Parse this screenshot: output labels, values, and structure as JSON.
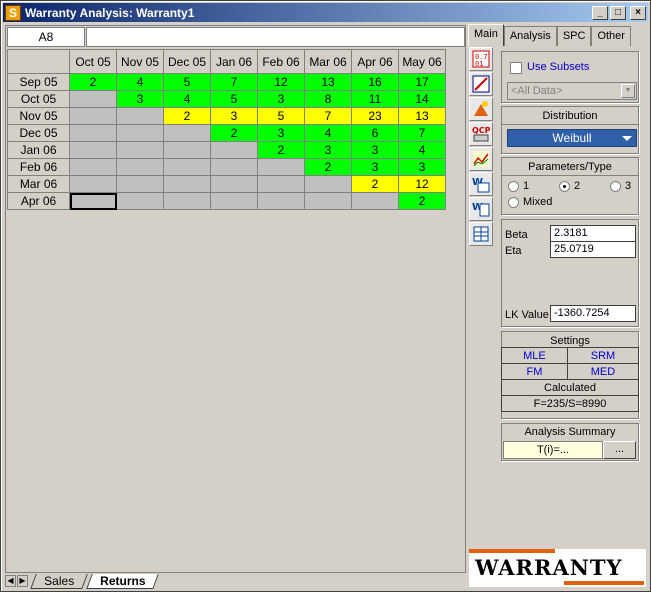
{
  "window": {
    "title": "Warranty Analysis: Warranty1",
    "minimize": "_",
    "maximize": "□",
    "close": "×"
  },
  "sheet": {
    "cell_ref": "A8",
    "formula": "",
    "columns": [
      "Oct 05",
      "Nov 05",
      "Dec 05",
      "Jan 06",
      "Feb 06",
      "Mar 06",
      "Apr 06",
      "May 06"
    ],
    "rows": [
      {
        "label": "Sep 05",
        "cells": [
          [
            "2",
            "g"
          ],
          [
            "4",
            "g"
          ],
          [
            "5",
            "g"
          ],
          [
            "7",
            "g"
          ],
          [
            "12",
            "g"
          ],
          [
            "13",
            "g"
          ],
          [
            "16",
            "g"
          ],
          [
            "17",
            "g"
          ]
        ]
      },
      {
        "label": "Oct 05",
        "cells": [
          [
            "",
            "e"
          ],
          [
            "3",
            "g"
          ],
          [
            "4",
            "g"
          ],
          [
            "5",
            "g"
          ],
          [
            "3",
            "g"
          ],
          [
            "8",
            "g"
          ],
          [
            "11",
            "g"
          ],
          [
            "14",
            "g"
          ]
        ]
      },
      {
        "label": "Nov 05",
        "cells": [
          [
            "",
            "e"
          ],
          [
            "",
            "e"
          ],
          [
            "2",
            "y"
          ],
          [
            "3",
            "y"
          ],
          [
            "5",
            "y"
          ],
          [
            "7",
            "y"
          ],
          [
            "23",
            "y"
          ],
          [
            "13",
            "y"
          ]
        ]
      },
      {
        "label": "Dec 05",
        "cells": [
          [
            "",
            "e"
          ],
          [
            "",
            "e"
          ],
          [
            "",
            "e"
          ],
          [
            "2",
            "g"
          ],
          [
            "3",
            "g"
          ],
          [
            "4",
            "g"
          ],
          [
            "6",
            "g"
          ],
          [
            "7",
            "g"
          ]
        ]
      },
      {
        "label": "Jan 06",
        "cells": [
          [
            "",
            "e"
          ],
          [
            "",
            "e"
          ],
          [
            "",
            "e"
          ],
          [
            "",
            "e"
          ],
          [
            "2",
            "g"
          ],
          [
            "3",
            "g"
          ],
          [
            "3",
            "g"
          ],
          [
            "4",
            "g"
          ]
        ]
      },
      {
        "label": "Feb 06",
        "cells": [
          [
            "",
            "e"
          ],
          [
            "",
            "e"
          ],
          [
            "",
            "e"
          ],
          [
            "",
            "e"
          ],
          [
            "",
            "e"
          ],
          [
            "2",
            "g"
          ],
          [
            "3",
            "g"
          ],
          [
            "3",
            "g"
          ]
        ]
      },
      {
        "label": "Mar 06",
        "cells": [
          [
            "",
            "e"
          ],
          [
            "",
            "e"
          ],
          [
            "",
            "e"
          ],
          [
            "",
            "e"
          ],
          [
            "",
            "e"
          ],
          [
            "",
            "e"
          ],
          [
            "2",
            "y"
          ],
          [
            "12",
            "y"
          ]
        ]
      },
      {
        "label": "Apr 06",
        "cells": [
          [
            "",
            "sel"
          ],
          [
            "",
            "e"
          ],
          [
            "",
            "e"
          ],
          [
            "",
            "e"
          ],
          [
            "",
            "e"
          ],
          [
            "",
            "e"
          ],
          [
            "",
            "e"
          ],
          [
            "2",
            "g"
          ]
        ]
      }
    ],
    "tabs": [
      "Sales",
      "Returns"
    ],
    "active_tab": "Returns"
  },
  "panel": {
    "tabs": [
      "Main",
      "Analysis",
      "SPC",
      "Other"
    ],
    "active_tab": "Main",
    "use_subsets": "Use Subsets",
    "subset_combo": "<All Data>",
    "distribution_header": "Distribution",
    "distribution_value": "Weibull",
    "params_header": "Parameters/Type",
    "param_options": [
      "1",
      "2",
      "3",
      "Mixed"
    ],
    "param_selected": "2",
    "beta_label": "Beta",
    "beta_value": "2.3181",
    "eta_label": "Eta",
    "eta_value": "25.0719",
    "lk_label": "LK Value",
    "lk_value": "-1360.7254",
    "settings_header": "Settings",
    "settings": [
      "MLE",
      "SRM",
      "FM",
      "MED"
    ],
    "calculated_label": "Calculated",
    "calculated_value": "F=235/S=8990",
    "summary_header": "Analysis Summary",
    "summary_value": "T(i)=...",
    "summary_button": "...",
    "logo_text": "WARRANTY"
  },
  "colors": {
    "green": "#00ff00",
    "yellow": "#ffff00",
    "empty": "#c0c0c0",
    "accent": "#3060a8"
  }
}
